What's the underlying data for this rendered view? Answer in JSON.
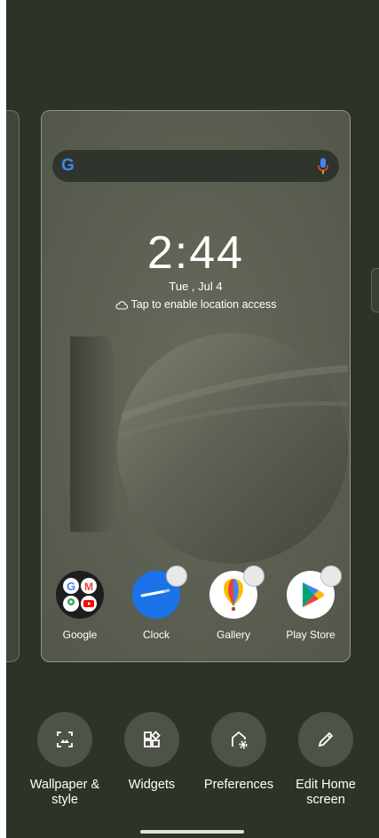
{
  "preview": {
    "clock_time": "2:44",
    "date": "Tue , Jul 4",
    "location_text": "Tap to enable location access",
    "search_logo": "G"
  },
  "apps": [
    {
      "label": "Google",
      "icon": "google-folder-icon"
    },
    {
      "label": "Clock",
      "icon": "clock-icon"
    },
    {
      "label": "Gallery",
      "icon": "gallery-balloon-icon"
    },
    {
      "label": "Play Store",
      "icon": "play-store-icon"
    }
  ],
  "actions": [
    {
      "label": "Wallpaper & style",
      "icon": "wallpaper-icon"
    },
    {
      "label": "Widgets",
      "icon": "widgets-icon"
    },
    {
      "label": "Preferences",
      "icon": "home-settings-icon"
    },
    {
      "label": "Edit Home screen",
      "icon": "pencil-icon"
    }
  ],
  "colors": {
    "background": "#2d3327",
    "action_button": "#4d5346",
    "clock_icon": "#1a73e8"
  }
}
